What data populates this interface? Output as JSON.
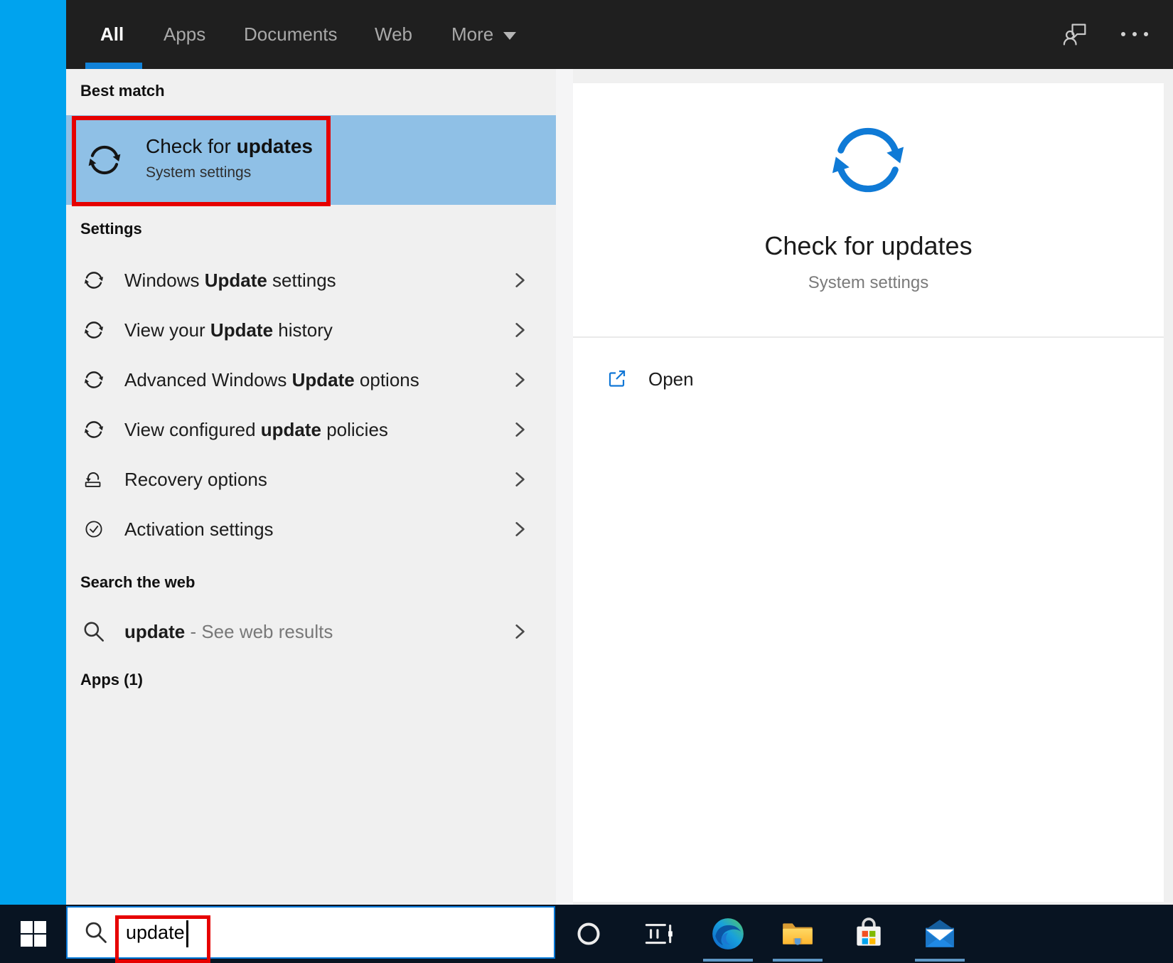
{
  "topbar": {
    "tabs": [
      {
        "label": "All",
        "active": true
      },
      {
        "label": "Apps",
        "active": false
      },
      {
        "label": "Documents",
        "active": false
      },
      {
        "label": "Web",
        "active": false
      },
      {
        "label": "More",
        "active": false,
        "has_caret": true
      }
    ],
    "feedback_icon": "person-chat-icon",
    "overflow_icon": "ellipsis-icon"
  },
  "left_panel": {
    "best_match_header": "Best match",
    "best_match": {
      "icon": "sync-icon",
      "title_segments": [
        {
          "t": "Check for ",
          "b": false
        },
        {
          "t": "updates",
          "b": true
        }
      ],
      "subtitle": "System settings"
    },
    "settings_header": "Settings",
    "settings_items": [
      {
        "icon": "sync-icon",
        "segments": [
          {
            "t": "Windows ",
            "b": false
          },
          {
            "t": "Update",
            "b": true
          },
          {
            "t": " settings",
            "b": false
          }
        ]
      },
      {
        "icon": "sync-icon",
        "segments": [
          {
            "t": "View your ",
            "b": false
          },
          {
            "t": "Update",
            "b": true
          },
          {
            "t": " history",
            "b": false
          }
        ]
      },
      {
        "icon": "sync-icon",
        "segments": [
          {
            "t": "Advanced Windows ",
            "b": false
          },
          {
            "t": "Update",
            "b": true
          },
          {
            "t": " options",
            "b": false
          }
        ]
      },
      {
        "icon": "sync-icon",
        "segments": [
          {
            "t": "View configured ",
            "b": false
          },
          {
            "t": "update",
            "b": true
          },
          {
            "t": " policies",
            "b": false
          }
        ]
      },
      {
        "icon": "recovery-icon",
        "segments": [
          {
            "t": "Recovery options",
            "b": false
          }
        ]
      },
      {
        "icon": "activation-icon",
        "segments": [
          {
            "t": "Activation settings",
            "b": false
          }
        ]
      }
    ],
    "web_header": "Search the web",
    "web_item": {
      "icon": "search-icon",
      "segments": [
        {
          "t": "update",
          "b": true
        },
        {
          "t": " - See web results",
          "b": false,
          "m": true
        }
      ]
    },
    "apps_header": "Apps (1)"
  },
  "preview": {
    "icon": "sync-icon",
    "title": "Check for updates",
    "subtitle": "System settings",
    "open_label": "Open",
    "open_icon": "open-external-icon"
  },
  "taskbar": {
    "start_icon": "windows-logo-icon",
    "search": {
      "value": "update",
      "icon": "search-icon"
    },
    "app_icons": [
      "cortana-icon",
      "task-view-icon",
      "edge-icon",
      "file-explorer-icon",
      "store-icon",
      "mail-icon"
    ],
    "running_indicators": [
      "edge",
      "file-explorer",
      "mail"
    ]
  },
  "annotations": {
    "count": 2,
    "color": "#e60000",
    "targets": [
      "best-match-result",
      "search-box-text"
    ]
  },
  "colors": {
    "accent_blue": "#0f7ad6",
    "selection_blue": "#8fc0e6",
    "desktop_blue": "#00a3ee",
    "topbar_bg": "#1f1f1f",
    "taskbar_bg": "#081422",
    "panel_bg": "#f0f0f0",
    "annotation_red": "#e60000"
  }
}
